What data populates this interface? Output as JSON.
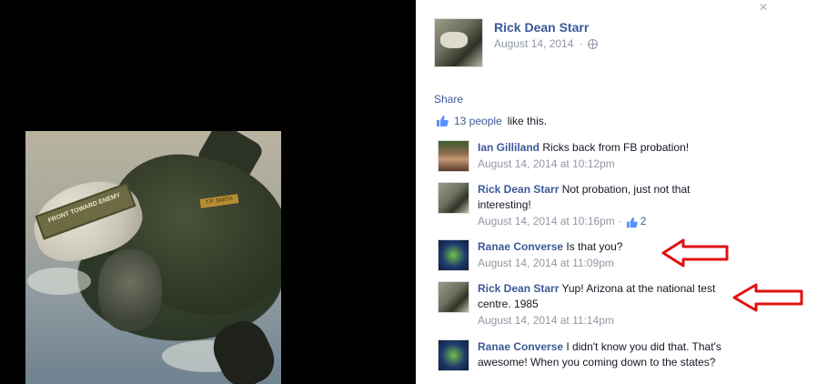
{
  "post": {
    "author": "Rick Dean Starr",
    "date": "August 14, 2014",
    "separator": "·",
    "share_label": "Share",
    "likes_count_text": "13 people",
    "likes_suffix": "like this.",
    "close_glyph": "×"
  },
  "photo": {
    "visor_text": "FRONT TOWARD ENEMY",
    "patch_text": "T.P. SMITH"
  },
  "comments": [
    {
      "author": "Ian Gilliland",
      "text": "Ricks back from FB probation!",
      "time": "August 14, 2014 at 10:12pm",
      "likes": "",
      "avatar": "ian-avatar"
    },
    {
      "author": "Rick Dean Starr",
      "text": "Not probation, just not that interesting!",
      "time": "August 14, 2014 at 10:16pm",
      "likes": "2",
      "avatar": "rick-avatar"
    },
    {
      "author": "Ranae Converse",
      "text": "Is that you?",
      "time": "August 14, 2014 at 11:09pm",
      "likes": "",
      "avatar": "ranae-avatar"
    },
    {
      "author": "Rick Dean Starr",
      "text": "Yup! Arizona at the national test centre. 1985",
      "time": "August 14, 2014 at 11:14pm",
      "likes": "",
      "avatar": "rick-avatar"
    },
    {
      "author": "Ranae Converse",
      "text": "I didn't know you did that. That's awesome! When you coming down to the states?",
      "time": "",
      "likes": "",
      "avatar": "ranae-avatar"
    }
  ],
  "colors": {
    "link_blue": "#3b5998",
    "meta_gray": "#9197a3",
    "annotation_red": "#e01010"
  },
  "icons": {
    "close": "close-icon",
    "globe": "globe-icon",
    "like": "thumb-icon",
    "annotation": "red-arrow-icon"
  }
}
